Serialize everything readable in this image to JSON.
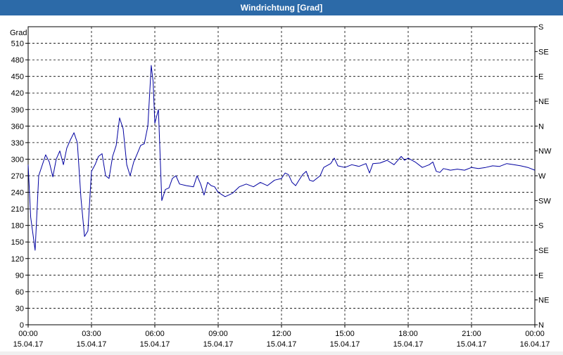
{
  "window": {
    "title": "Windrichtung [Grad]"
  },
  "colors": {
    "titlebar": "#2c6aa8",
    "series": "#0000a0",
    "grid": "#000000",
    "background": "#ffffff"
  },
  "chart_data": {
    "type": "line",
    "title": "Windrichtung [Grad]",
    "ylabel": "Grad",
    "ylim": [
      0,
      540
    ],
    "yticks": [
      0,
      30,
      60,
      90,
      120,
      150,
      180,
      210,
      240,
      270,
      300,
      330,
      360,
      390,
      420,
      450,
      480,
      510
    ],
    "right_axis_labels": [
      "N",
      "NE",
      "E",
      "SE",
      "S",
      "SW",
      "W",
      "NW",
      "N",
      "NE",
      "E",
      "SE",
      "S"
    ],
    "xlim_hours": [
      0,
      24
    ],
    "x_ticks": [
      {
        "time": "00:00",
        "date": "15.04.17"
      },
      {
        "time": "03:00",
        "date": "15.04.17"
      },
      {
        "time": "06:00",
        "date": "15.04.17"
      },
      {
        "time": "09:00",
        "date": "15.04.17"
      },
      {
        "time": "12:00",
        "date": "15.04.17"
      },
      {
        "time": "15:00",
        "date": "15.04.17"
      },
      {
        "time": "18:00",
        "date": "15.04.17"
      },
      {
        "time": "21:00",
        "date": "15.04.17"
      },
      {
        "time": "00:00",
        "date": "16.04.17"
      }
    ],
    "grid": true,
    "series": [
      {
        "points": [
          [
            0.0,
            290
          ],
          [
            0.12,
            195
          ],
          [
            0.33,
            135
          ],
          [
            0.5,
            270
          ],
          [
            0.83,
            308
          ],
          [
            1.0,
            295
          ],
          [
            1.17,
            268
          ],
          [
            1.33,
            300
          ],
          [
            1.5,
            315
          ],
          [
            1.67,
            290
          ],
          [
            1.83,
            320
          ],
          [
            2.0,
            335
          ],
          [
            2.17,
            348
          ],
          [
            2.33,
            330
          ],
          [
            2.5,
            230
          ],
          [
            2.67,
            160
          ],
          [
            2.83,
            170
          ],
          [
            3.0,
            278
          ],
          [
            3.17,
            290
          ],
          [
            3.33,
            305
          ],
          [
            3.5,
            310
          ],
          [
            3.67,
            270
          ],
          [
            3.83,
            265
          ],
          [
            4.0,
            305
          ],
          [
            4.17,
            325
          ],
          [
            4.33,
            375
          ],
          [
            4.5,
            355
          ],
          [
            4.67,
            290
          ],
          [
            4.83,
            270
          ],
          [
            5.0,
            295
          ],
          [
            5.17,
            310
          ],
          [
            5.33,
            325
          ],
          [
            5.5,
            328
          ],
          [
            5.67,
            360
          ],
          [
            5.83,
            470
          ],
          [
            5.92,
            440
          ],
          [
            6.0,
            365
          ],
          [
            6.17,
            390
          ],
          [
            6.33,
            225
          ],
          [
            6.5,
            245
          ],
          [
            6.67,
            248
          ],
          [
            6.83,
            265
          ],
          [
            7.0,
            270
          ],
          [
            7.17,
            255
          ],
          [
            7.5,
            252
          ],
          [
            7.83,
            250
          ],
          [
            8.0,
            270
          ],
          [
            8.17,
            255
          ],
          [
            8.33,
            235
          ],
          [
            8.5,
            258
          ],
          [
            8.67,
            252
          ],
          [
            8.83,
            250
          ],
          [
            9.0,
            240
          ],
          [
            9.33,
            232
          ],
          [
            9.67,
            238
          ],
          [
            10.0,
            250
          ],
          [
            10.33,
            255
          ],
          [
            10.67,
            250
          ],
          [
            11.0,
            258
          ],
          [
            11.33,
            252
          ],
          [
            11.67,
            262
          ],
          [
            12.0,
            265
          ],
          [
            12.17,
            275
          ],
          [
            12.33,
            272
          ],
          [
            12.5,
            258
          ],
          [
            12.67,
            252
          ],
          [
            12.83,
            262
          ],
          [
            13.0,
            272
          ],
          [
            13.17,
            278
          ],
          [
            13.33,
            262
          ],
          [
            13.5,
            260
          ],
          [
            13.83,
            270
          ],
          [
            14.0,
            285
          ],
          [
            14.33,
            292
          ],
          [
            14.5,
            302
          ],
          [
            14.67,
            288
          ],
          [
            15.0,
            285
          ],
          [
            15.33,
            290
          ],
          [
            15.67,
            287
          ],
          [
            16.0,
            292
          ],
          [
            16.17,
            275
          ],
          [
            16.33,
            292
          ],
          [
            16.67,
            293
          ],
          [
            17.0,
            298
          ],
          [
            17.33,
            290
          ],
          [
            17.67,
            305
          ],
          [
            17.83,
            298
          ],
          [
            18.0,
            302
          ],
          [
            18.33,
            295
          ],
          [
            18.67,
            285
          ],
          [
            19.0,
            290
          ],
          [
            19.17,
            295
          ],
          [
            19.33,
            278
          ],
          [
            19.5,
            276
          ],
          [
            19.67,
            283
          ],
          [
            20.0,
            280
          ],
          [
            20.33,
            282
          ],
          [
            20.67,
            280
          ],
          [
            21.0,
            285
          ],
          [
            21.33,
            283
          ],
          [
            21.67,
            285
          ],
          [
            22.0,
            288
          ],
          [
            22.33,
            287
          ],
          [
            22.67,
            292
          ],
          [
            23.0,
            290
          ],
          [
            23.33,
            288
          ],
          [
            23.67,
            285
          ],
          [
            24.0,
            280
          ]
        ]
      }
    ]
  }
}
